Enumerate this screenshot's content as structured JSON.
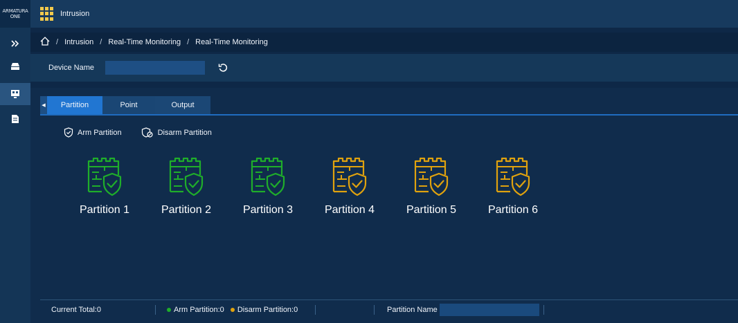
{
  "logo": {
    "line1": "ARMATURA",
    "line2": "ONE"
  },
  "header": {
    "app_title": "Intrusion"
  },
  "breadcrumb": {
    "items": [
      "Intrusion",
      "Real-Time Monitoring",
      "Real-Time Monitoring"
    ],
    "separator": "/"
  },
  "filter": {
    "device_name_label": "Device Name",
    "device_name_value": ""
  },
  "tabs": [
    {
      "label": "Partition",
      "active": true
    },
    {
      "label": "Point",
      "active": false
    },
    {
      "label": "Output",
      "active": false
    }
  ],
  "actions": {
    "arm_label": "Arm Partition",
    "disarm_label": "Disarm Partition"
  },
  "partitions": [
    {
      "name": "Partition 1",
      "state": "armed",
      "color": "#1fae2a"
    },
    {
      "name": "Partition 2",
      "state": "armed",
      "color": "#1fae2a"
    },
    {
      "name": "Partition 3",
      "state": "armed",
      "color": "#1fae2a"
    },
    {
      "name": "Partition 4",
      "state": "disarmed",
      "color": "#e0a20e"
    },
    {
      "name": "Partition 5",
      "state": "disarmed",
      "color": "#e0a20e"
    },
    {
      "name": "Partition 6",
      "state": "disarmed",
      "color": "#e0a20e"
    }
  ],
  "status": {
    "current_total": "Current Total:0",
    "arm_count": "Arm Partition:0",
    "disarm_count": "Disarm Partition:0",
    "partition_name_label": "Partition Name",
    "partition_name_value": "",
    "arm_color": "#1fae2a",
    "disarm_color": "#e0a20e"
  },
  "icons": {
    "expand": "double-chevron-right-icon",
    "monitor": "monitor-icon",
    "device": "device-icon",
    "report": "report-icon",
    "home": "home-icon",
    "refresh": "refresh-icon"
  }
}
